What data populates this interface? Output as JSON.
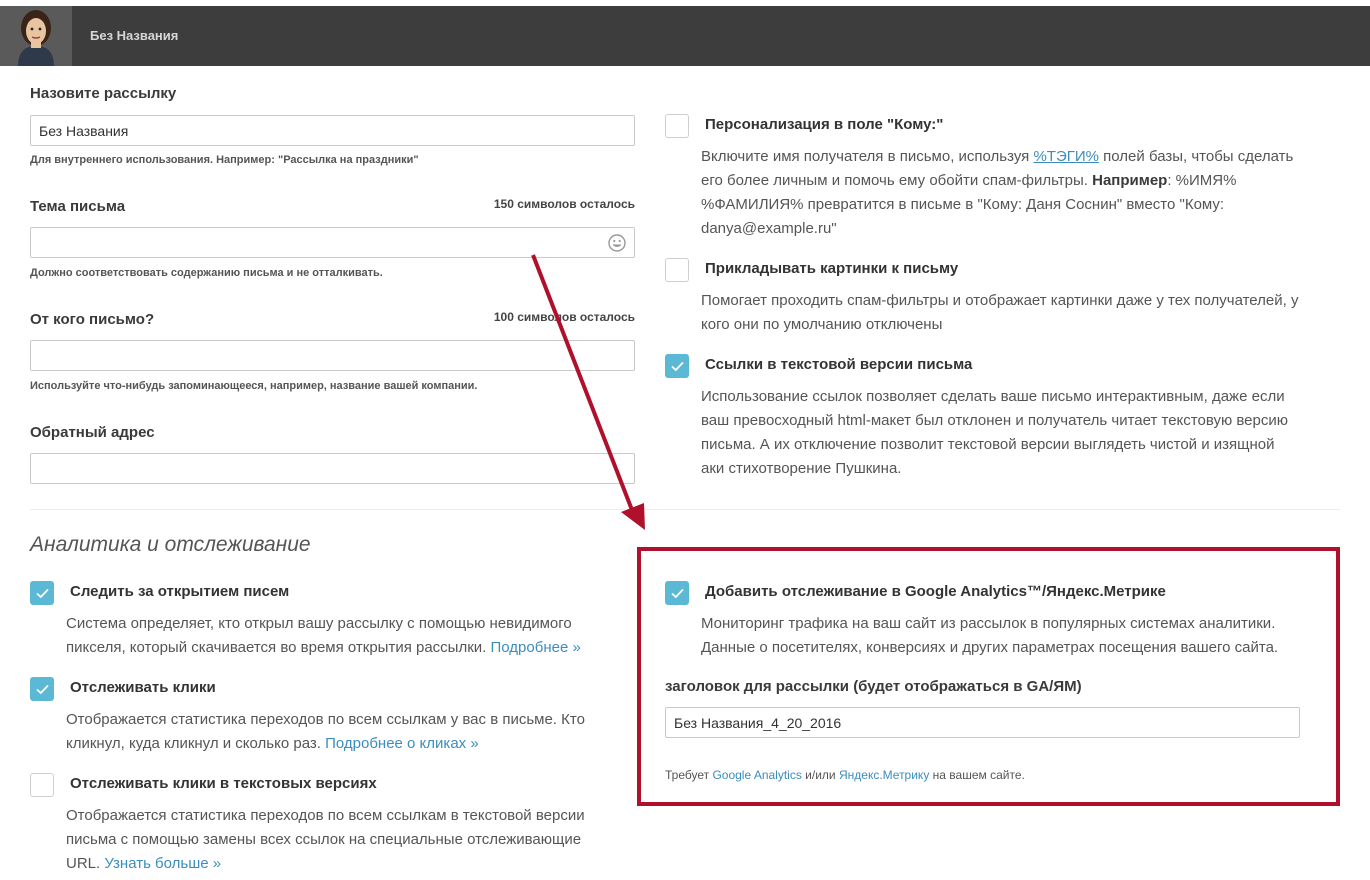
{
  "header": {
    "title": "Без Названия",
    "avatar_icon": "woman-avatar-icon"
  },
  "form": {
    "name": {
      "label": "Назовите рассылку",
      "value": "Без Названия",
      "help": "Для внутреннего использования. Например: \"Рассылка на праздники\""
    },
    "subject": {
      "label": "Тема письма",
      "counter": "150 символов осталось",
      "value": "",
      "help": "Должно соответствовать содержанию письма и не отталкивать."
    },
    "from": {
      "label": "От кого письмо?",
      "counter": "100 символов осталось",
      "value": "",
      "help": "Используйте что-нибудь запоминающееся, например, название вашей компании."
    },
    "reply": {
      "label": "Обратный адрес",
      "value": ""
    }
  },
  "options": {
    "personalize": {
      "checked": false,
      "title": "Персонализация в поле \"Кому:\"",
      "desc_1": "Включите имя получателя в письмо, используя ",
      "tag_link": "%ТЭГИ%",
      "desc_2": " полей базы, чтобы сделать",
      "desc_3": "его более личным и помочь ему обойти спам-фильтры. ",
      "example_bold": "Например",
      "desc_4": ": %ИМЯ%",
      "desc_5": "%ФАМИЛИЯ% превратится в письме в \"Кому: Даня Соснин\" вместо \"Кому:",
      "desc_6": "danya@example.ru\""
    },
    "images": {
      "checked": false,
      "title": "Прикладывать картинки к письму",
      "desc_1": "Помогает проходить спам-фильтры и отображает картинки даже у тех получателей, у",
      "desc_2": "кого они по умолчанию отключены"
    },
    "text_links": {
      "checked": true,
      "title": "Ссылки в текстовой версии письма",
      "desc_1": "Использование ссылок позволяет сделать ваше письмо интерактивным, даже если",
      "desc_2": "ваш превосходный html-макет был отклонен и получатель читает текстовую версию",
      "desc_3": "письма. А их отключение позволит текстовой версии выглядеть чистой и изящной",
      "desc_4": "аки стихотворение Пушкина."
    }
  },
  "analytics": {
    "section_title": "Аналитика и отслеживание",
    "opens": {
      "checked": true,
      "title": "Следить за открытием писем",
      "desc_1": "Система определяет, кто открыл вашу рассылку с помощью невидимого",
      "desc_2": "пикселя, который скачивается во время открытия рассылки. ",
      "link": "Подробнее »"
    },
    "clicks": {
      "checked": true,
      "title": "Отслеживать клики",
      "desc_1": "Отображается статистика переходов по всем ссылкам у вас в письме. Кто",
      "desc_2": "кликнул, куда кликнул и сколько раз. ",
      "link": "Подробнее о кликах »"
    },
    "text_clicks": {
      "checked": false,
      "title": "Отслеживать клики в текстовых версиях",
      "desc_1": "Отображается статистика переходов по всем ссылкам в текстовой версии",
      "desc_2": "письма с помощью замены всех ссылок на специальные отслеживающие",
      "desc_3": "URL. ",
      "link": "Узнать больше »"
    },
    "ga": {
      "checked": true,
      "title": "Добавить отслеживание в Google Analytics™/Яндекс.Метрике",
      "desc_1": "Мониторинг трафика на ваш сайт из рассылок в популярных системах аналитики.",
      "desc_2": "Данные о посетителях, конверсиях и других параметрах посещения вашего сайта.",
      "campaign_label": "заголовок для рассылки (будет отображаться в GA/ЯМ)",
      "campaign_value": "Без Названия_4_20_2016",
      "req_1": "Требует ",
      "req_link_1": "Google Analytics",
      "req_2": " и/или ",
      "req_link_2": "Яндекс.Метрику",
      "req_3": " на вашем сайте."
    }
  },
  "colors": {
    "accent": "#5bb9d6",
    "highlight": "#b0102b",
    "link": "#3b8dbd",
    "header": "#3d3d3d"
  }
}
